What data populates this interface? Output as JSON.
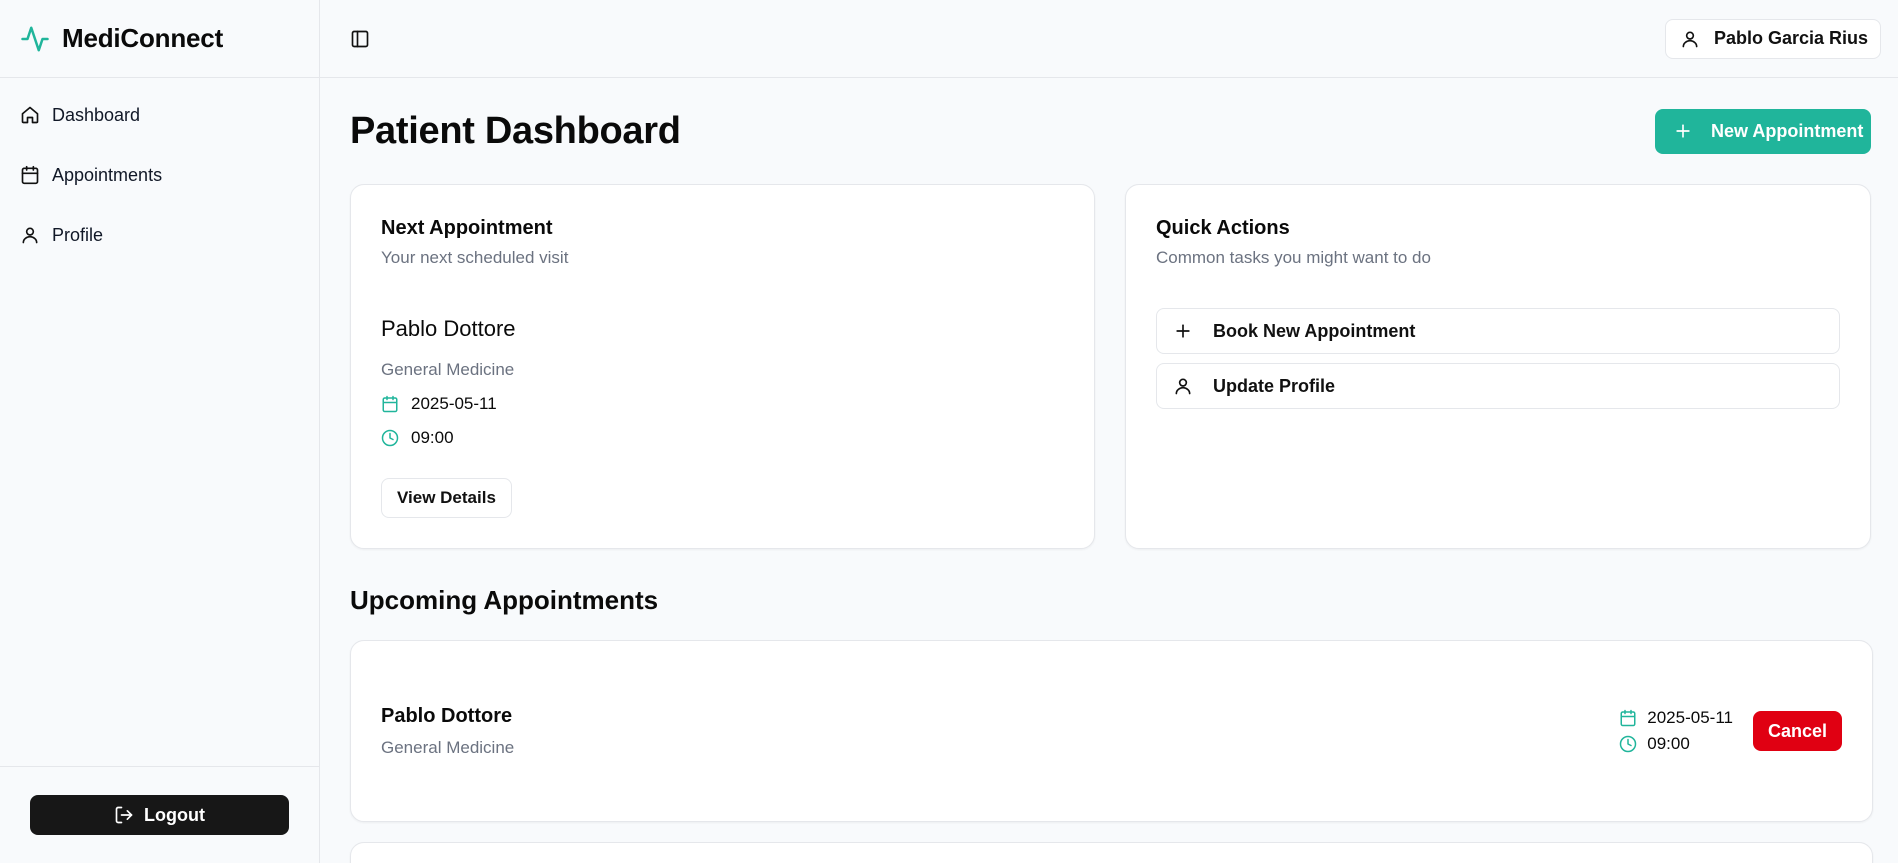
{
  "app": {
    "name": "MediConnect",
    "brand_color": "#20b59b"
  },
  "sidebar": {
    "items": [
      {
        "label": "Dashboard",
        "icon": "home-icon"
      },
      {
        "label": "Appointments",
        "icon": "calendar-icon"
      },
      {
        "label": "Profile",
        "icon": "user-icon"
      }
    ],
    "logout_label": "Logout"
  },
  "header": {
    "user_name": "Pablo Garcia Rius"
  },
  "page": {
    "title": "Patient Dashboard",
    "new_appointment_label": "New Appointment"
  },
  "next_appointment": {
    "title": "Next Appointment",
    "subtitle": "Your next scheduled visit",
    "doctor": "Pablo Dottore",
    "specialty": "General Medicine",
    "date": "2025-05-11",
    "time": "09:00",
    "view_details_label": "View Details"
  },
  "quick_actions": {
    "title": "Quick Actions",
    "subtitle": "Common tasks you might want to do",
    "actions": [
      {
        "label": "Book New Appointment",
        "icon": "plus-icon"
      },
      {
        "label": "Update Profile",
        "icon": "user-icon"
      }
    ]
  },
  "upcoming": {
    "title": "Upcoming Appointments",
    "items": [
      {
        "doctor": "Pablo Dottore",
        "specialty": "General Medicine",
        "date": "2025-05-11",
        "time": "09:00",
        "cancel_label": "Cancel"
      }
    ]
  },
  "colors": {
    "accent": "#20b59b",
    "danger": "#e00012",
    "dark": "#171717"
  }
}
